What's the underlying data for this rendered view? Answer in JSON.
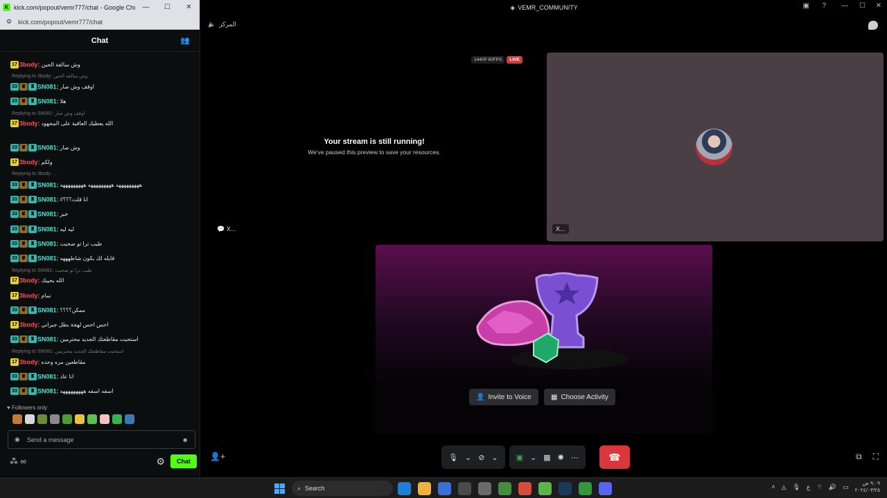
{
  "browser": {
    "title": "kick.com/popout/vemr777/chat - Google Chro...",
    "url": "kick.com/popout/vemr777/chat",
    "favicon": "K"
  },
  "chat": {
    "header": "Chat",
    "followers_only": "Followers only",
    "input_placeholder": "Send a message",
    "send_label": "Chat",
    "messages": [
      {
        "badge": "17",
        "user": "3body:",
        "text": "وش سالفة الحين"
      },
      {
        "reply": "Replying to 3body: وش سالفة الحين"
      },
      {
        "badge": "33",
        "user": "SN081:",
        "text": "اوقف وش صار"
      },
      {
        "badge": "33",
        "user": "SN081:",
        "text": "هلا"
      },
      {
        "reply": "Replying to SN081: اوقف وش صار"
      },
      {
        "badge": "17",
        "user": "3body:",
        "text": "الله يعطيك العافية على المجهود"
      },
      {
        "badge": "33",
        "user": "SN081:",
        "text": "وش صار"
      },
      {
        "badge": "17",
        "user": "3body:",
        "text": "ولكم"
      },
      {
        "reply": "Replying to 3body: ..."
      },
      {
        "badge": "33",
        "user": "SN081:",
        "text": "هههههههههه هههههههههه هههههههههه"
      },
      {
        "badge": "33",
        "user": "SN081:",
        "text": "//انا قلت؟؟؟"
      },
      {
        "badge": "33",
        "user": "SN081:",
        "text": "خير"
      },
      {
        "badge": "33",
        "user": "SN081:",
        "text": "ليه ليه"
      },
      {
        "badge": "33",
        "user": "SN081:",
        "text": "طيب ترا تو صحيت"
      },
      {
        "badge": "33",
        "user": "SN081:",
        "text": "قايله لك بكون شاطهههه"
      },
      {
        "reply": "Replying to SN081: طيب ترا تو صحيت"
      },
      {
        "badge": "17",
        "user": "3body:",
        "text": "الله يحييك"
      },
      {
        "badge": "17",
        "user": "3body:",
        "text": "تمام"
      },
      {
        "badge": "33",
        "user": "SN081:",
        "text": "ممكن؟؟؟؟"
      },
      {
        "badge": "17",
        "user": "3body:",
        "text": "احس احس لهجة بطل جيراني"
      },
      {
        "badge": "33",
        "user": "SN081:",
        "text": "استحيت مقاطعتك الجديد محترمين"
      },
      {
        "reply": "Replying to SN081: استحيت مقاطعتك الجديد محترمين"
      },
      {
        "badge": "17",
        "user": "3body:",
        "text": "مقاطعين مره وحده"
      },
      {
        "badge": "33",
        "user": "SN081:",
        "text": "انا عاد"
      },
      {
        "badge": "33",
        "user": "SN081:",
        "text": "اسفه اسفه هههههههههه"
      }
    ]
  },
  "discord": {
    "window_title": "VEMR_COMMUNITY",
    "channel_name": "المركز",
    "stream_quality": "1440P 60FPS",
    "live_label": "LIVE",
    "paused_title": "Your stream is still running!",
    "paused_subtitle": "We've paused this preview to save your resources.",
    "tile_label_left": "X...",
    "tile_label_right": "X...",
    "invite_label": "Invite to Voice",
    "activity_label": "Choose Activity"
  },
  "taskbar": {
    "search_label": "Search",
    "time": "٩:٠٩ ص",
    "date": "٢٠٢٤/٠٣/٢٥"
  },
  "colors": {
    "kick_green": "#53fc18",
    "user_red": "#ff4b5c",
    "user_cyan": "#3ee8d6",
    "hangup_red": "#da373c"
  }
}
